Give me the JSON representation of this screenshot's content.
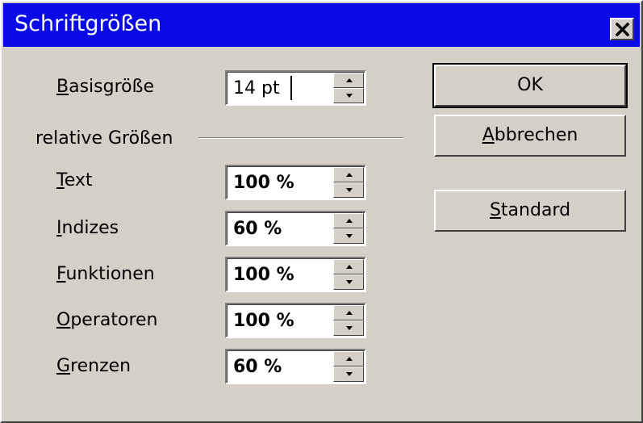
{
  "window": {
    "title": "Schriftgrößen"
  },
  "base_size": {
    "label_hotkey": "B",
    "label_rest": "asisgröße",
    "value": "14 pt"
  },
  "group": {
    "label": "relative Größen"
  },
  "fields": [
    {
      "label_hotkey": "T",
      "label_rest": "ext",
      "value": "100 %"
    },
    {
      "label_hotkey": "I",
      "label_rest": "ndizes",
      "value": "60 %"
    },
    {
      "label_hotkey": "F",
      "label_rest": "unktionen",
      "value": "100 %"
    },
    {
      "label_hotkey": "O",
      "label_rest": "peratoren",
      "value": "100 %"
    },
    {
      "label_hotkey": "G",
      "label_rest": "renzen",
      "value": "60 %"
    }
  ],
  "buttons": {
    "ok": {
      "label": "OK"
    },
    "cancel": {
      "hotkey": "A",
      "rest": "bbrechen"
    },
    "default": {
      "hotkey": "S",
      "rest": "tandard"
    }
  },
  "colors": {
    "titlebar": "#0a0ae6",
    "face": "#d4d0c8"
  }
}
